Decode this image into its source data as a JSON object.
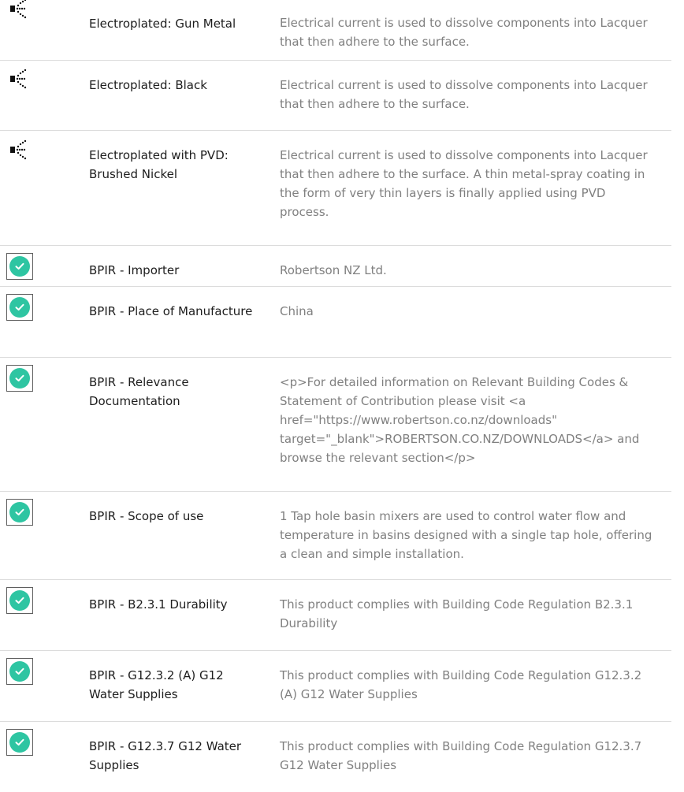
{
  "rows": [
    {
      "icon": "spray-icon",
      "label": "Electroplated: Gun Metal",
      "value": "Electrical current is used to dissolve components into Lacquer that then adhere to the surface."
    },
    {
      "icon": "spray-icon",
      "label": "Electroplated: Black",
      "value": "Electrical current is used to dissolve components into Lacquer that then adhere to the surface."
    },
    {
      "icon": "spray-icon",
      "label": "Electroplated with PVD: Brushed Nickel",
      "value": "Electrical current is used to dissolve components into Lacquer that then adhere to the surface. A thin metal-spray coating in the form of very thin layers is finally applied using PVD process."
    },
    {
      "icon": "check-circle-icon",
      "label": "BPIR - Importer",
      "value": "Robertson NZ Ltd."
    },
    {
      "icon": "check-circle-icon",
      "label": "BPIR - Place of Manufacture",
      "value": "China"
    },
    {
      "icon": "check-circle-icon",
      "label": "BPIR - Relevance Documentation",
      "value": "<p>For detailed information on Relevant Building Codes & Statement of Contribution please visit <a href=\"https://www.robertson.co.nz/downloads\" target=\"_blank\">ROBERTSON.CO.NZ/DOWNLOADS</a> and browse the relevant section</p>"
    },
    {
      "icon": "check-circle-icon",
      "label": "BPIR - Scope of use",
      "value": "1 Tap hole basin mixers are used to control water flow and temperature in basins designed with a single tap hole, offering a clean and simple installation."
    },
    {
      "icon": "check-circle-icon",
      "label": "BPIR - B2.3.1 Durability",
      "value": "This product complies with Building Code Regulation B2.3.1 Durability"
    },
    {
      "icon": "check-circle-icon",
      "label": "BPIR - G12.3.2 (A) G12 Water Supplies",
      "value": "This product complies with Building Code Regulation G12.3.2 (A) G12 Water Supplies"
    },
    {
      "icon": "check-circle-icon",
      "label": "BPIR - G12.3.7 G12 Water Supplies",
      "value": "This product complies with Building Code Regulation G12.3.7 G12 Water Supplies"
    }
  ],
  "colors": {
    "check": "#2ec5a2",
    "label": "#1d1d1d",
    "value": "#808080",
    "divider": "#dcdcdc"
  }
}
